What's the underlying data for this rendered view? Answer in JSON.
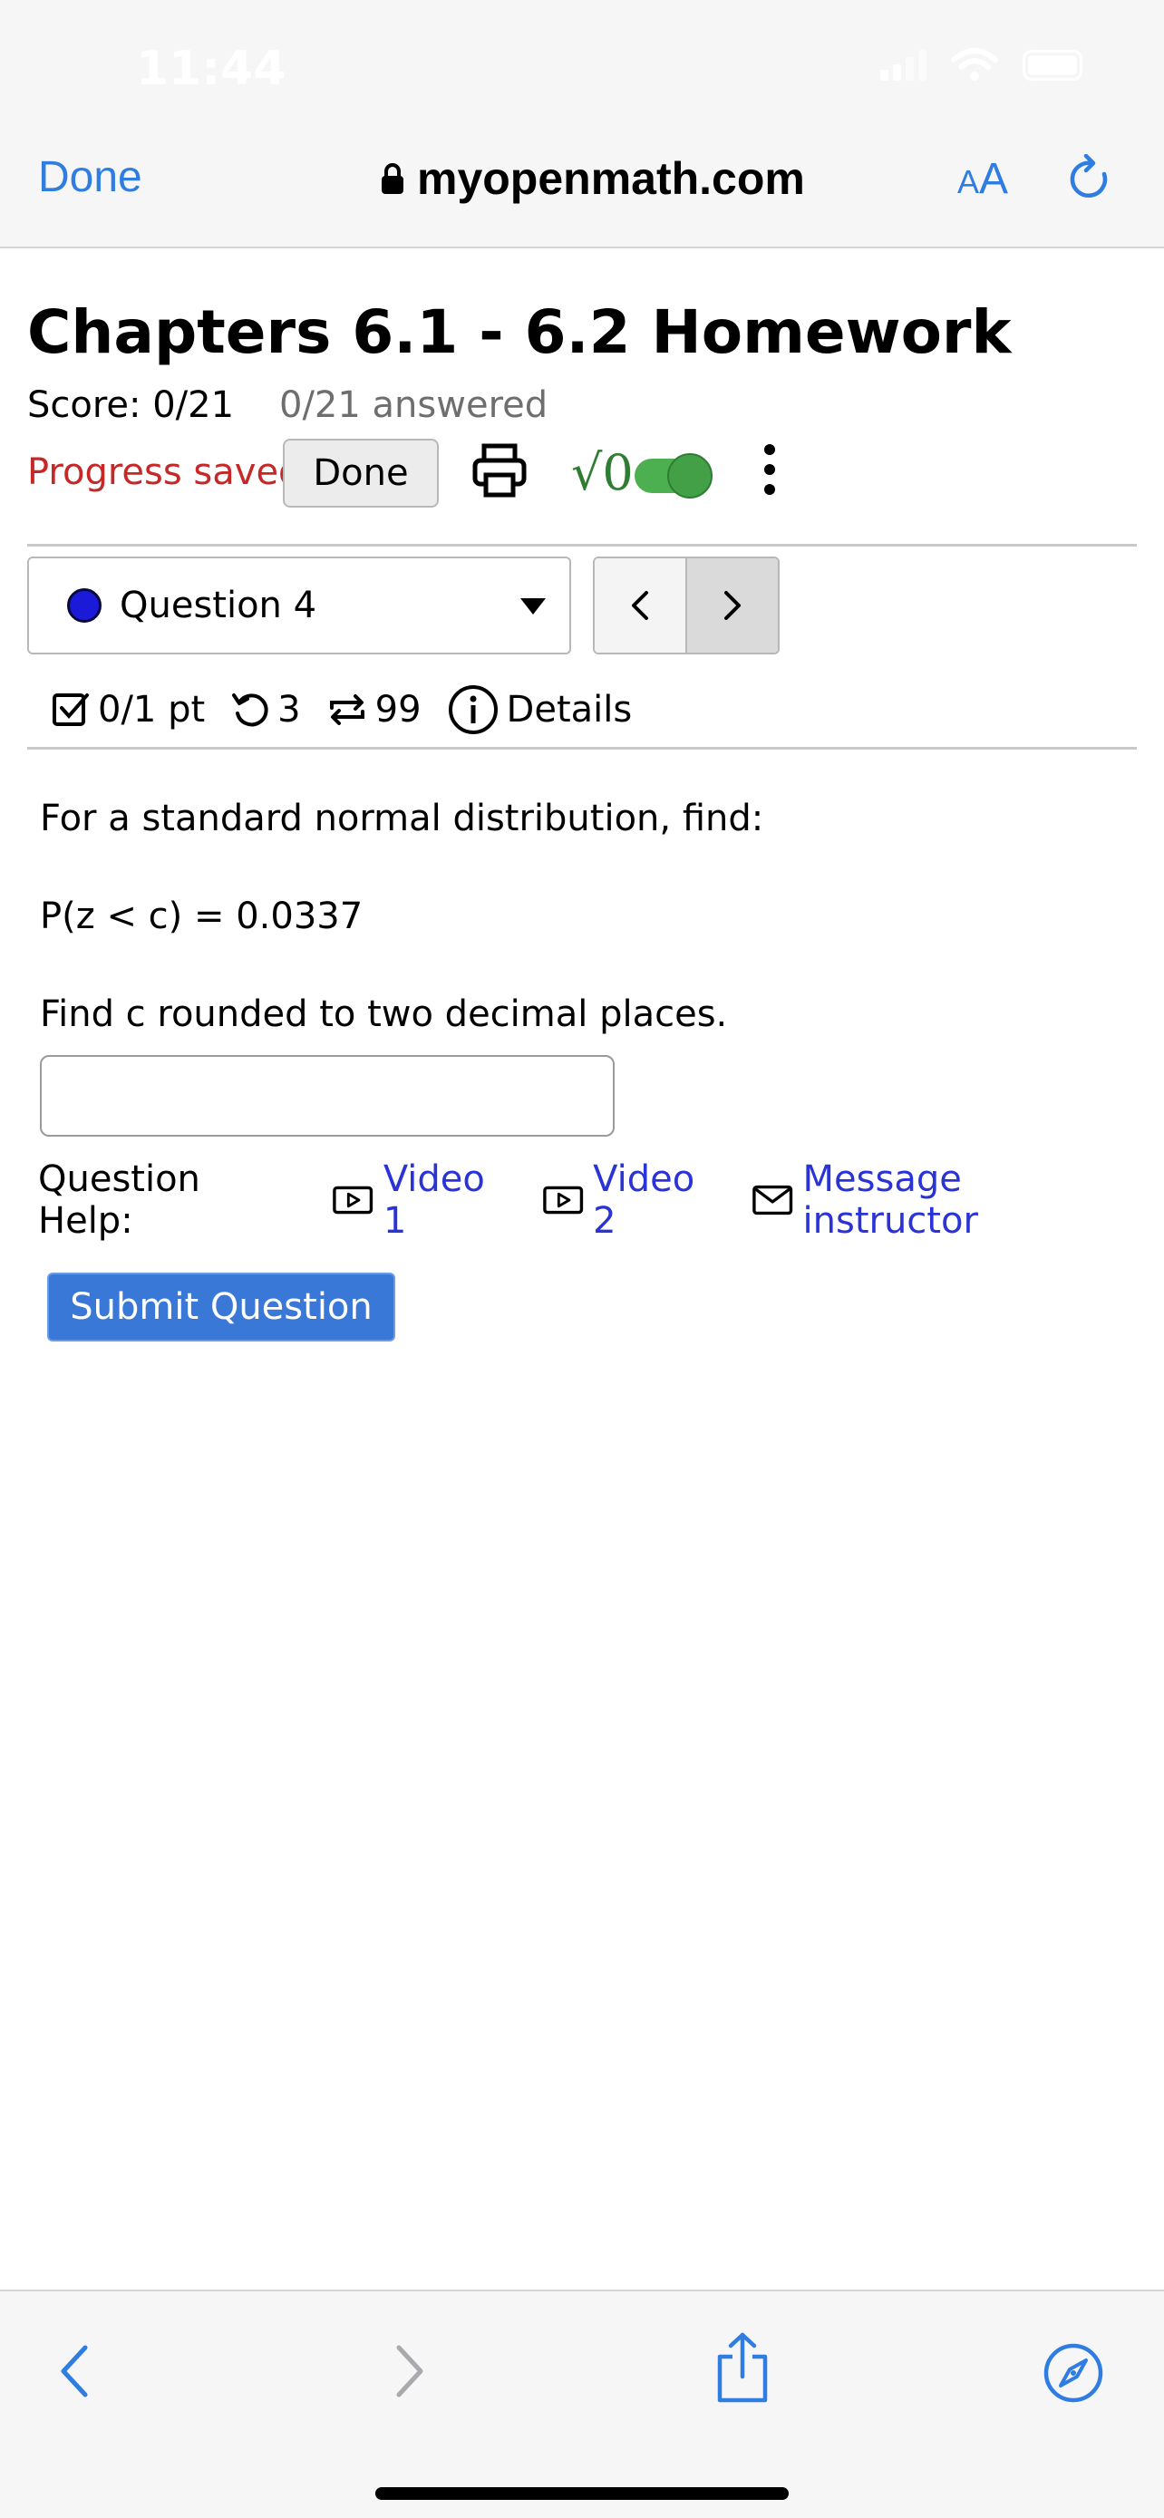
{
  "status_bar": {
    "time": "11:44"
  },
  "browser": {
    "done_label": "Done",
    "url": "myopenmath.com",
    "text_size_small": "A",
    "text_size_big": "A"
  },
  "assignment": {
    "title": "Chapters 6.1 - 6.2 Homework",
    "score": "Score: 0/21",
    "answered": "0/21 answered",
    "progress": "Progress saved",
    "done_button": "Done",
    "math_toggle_label": "√0"
  },
  "question_nav": {
    "selected": "Question 4",
    "prev": "<",
    "next": ">"
  },
  "question_meta": {
    "points": "0/1 pt",
    "retries": "3",
    "attempts": "99",
    "details": "Details"
  },
  "question": {
    "line1": "For a standard normal distribution, find:",
    "line2": "P(z < c) = 0.0337",
    "line3": "Find c rounded to two decimal places.",
    "answer_value": ""
  },
  "help": {
    "label": "Question Help:",
    "video1": "Video 1",
    "video2": "Video 2",
    "message": "Message instructor"
  },
  "submit_label": "Submit Question",
  "colors": {
    "accent_blue": "#2f7de1",
    "link_blue": "#2a33d6",
    "progress_red": "#c62828",
    "submit_blue": "#3a78d8",
    "toggle_green": "#4caf50"
  }
}
